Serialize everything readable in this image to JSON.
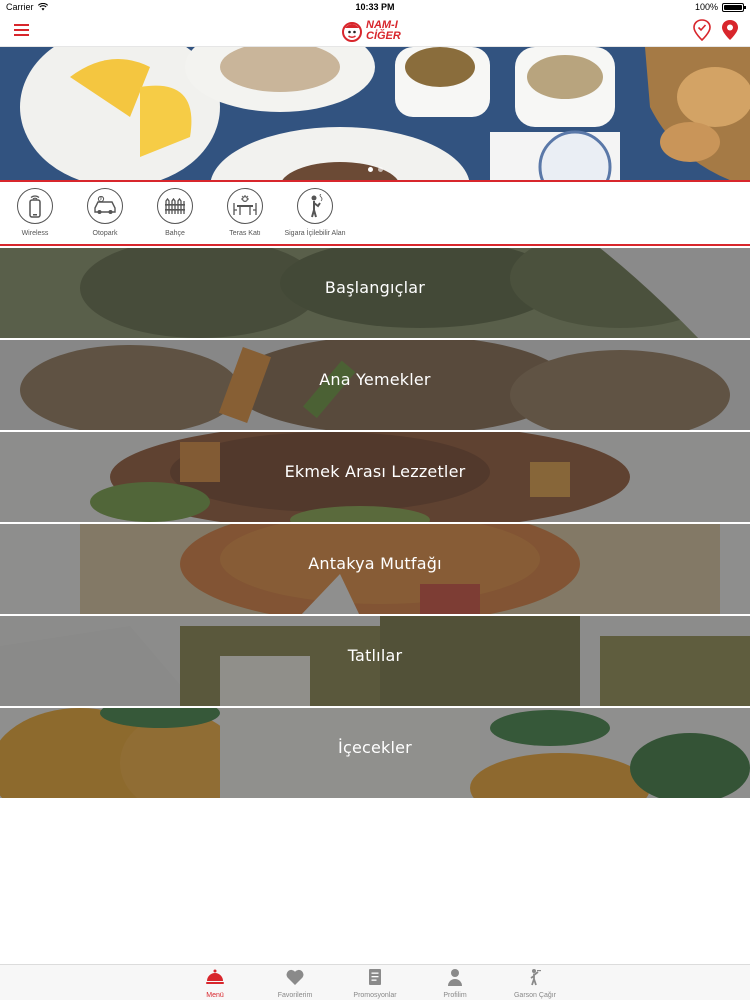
{
  "status_bar": {
    "carrier": "Carrier",
    "time": "10:33 PM",
    "battery": "100%"
  },
  "brand": {
    "logo_line1": "NAM-I",
    "logo_line2": "CİĞER",
    "accent_color": "#d8262c"
  },
  "hero": {
    "slides": 2,
    "active_slide": 1
  },
  "amenities": [
    {
      "label": "Wireless",
      "icon": "wireless-phone-icon"
    },
    {
      "label": "Otopark",
      "icon": "parking-car-icon"
    },
    {
      "label": "Bahçe",
      "icon": "garden-fence-icon"
    },
    {
      "label": "Teras Katı",
      "icon": "terrace-table-icon"
    },
    {
      "label": "Sigara İçilebilir Alan",
      "icon": "smoking-area-icon"
    }
  ],
  "categories": [
    {
      "label": "Başlangıçlar"
    },
    {
      "label": "Ana Yemekler"
    },
    {
      "label": "Ekmek Arası Lezzetler"
    },
    {
      "label": "Antakya Mutfağı"
    },
    {
      "label": "Tatlılar"
    },
    {
      "label": "İçecekler"
    }
  ],
  "tabs": [
    {
      "label": "Menü",
      "icon": "cloche-icon",
      "active": true
    },
    {
      "label": "Favorilerim",
      "icon": "heart-icon"
    },
    {
      "label": "Promosyonlar",
      "icon": "document-icon"
    },
    {
      "label": "Profilim",
      "icon": "person-icon"
    },
    {
      "label": "Garson Çağır",
      "icon": "waiter-icon"
    }
  ]
}
